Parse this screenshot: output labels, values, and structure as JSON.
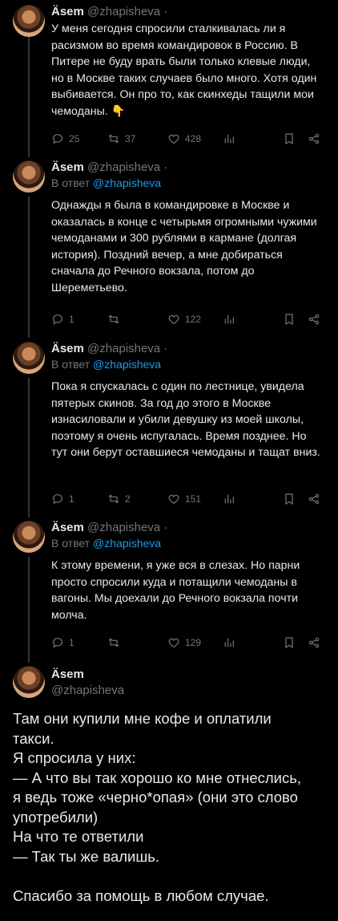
{
  "tweets": [
    {
      "name": "Äsem",
      "handle": "@zhapisheva ·",
      "reply_to": "",
      "text": "У меня сегодня спросили сталкивалась ли я расизмом во время командировок в Россию. В Питере не буду врать были только клевые люди, но в Москве таких случаев было много. Хотя один выбивается. Он про то, как скинхеды тащили мои чемоданы. 👇",
      "stats": {
        "replies": "25",
        "retweets": "37",
        "likes": "428"
      }
    },
    {
      "name": "Äsem",
      "handle": "@zhapisheva ·",
      "reply_prefix": "В ответ",
      "reply_to": "@zhapisheva",
      "text": "Однажды я была в командировке в Москве и оказалась в конце с четырьмя огромными чужими чемоданами и 300 рублями в кармане (долгая история). Поздний вечер, а мне добираться сначала до Речного вокзала, потом до Шереметьево.",
      "stats": {
        "replies": "1",
        "retweets": "",
        "likes": "122"
      }
    },
    {
      "name": "Äsem",
      "handle": "@zhapisheva ·",
      "reply_prefix": "В ответ",
      "reply_to": "@zhapisheva",
      "text": "Пока я спускалась с один по лестнице, увидела пятерых скинов. За год до этого в Москве изнасиловали и убили девушку из моей школы, поэтому я очень испугалась. Время позднее. Но тут они берут оставшиеся чемоданы и тащат вниз.",
      "stats": {
        "replies": "1",
        "retweets": "2",
        "likes": "151"
      }
    },
    {
      "name": "Äsem",
      "handle": "@zhapisheva ·",
      "reply_prefix": "В ответ",
      "reply_to": "@zhapisheva",
      "text": "К этому времени, я уже вся в слезах. Но парни просто спросили куда и потащили чемоданы в вагоны. Мы доехали до Речного вокзала почти молча.",
      "stats": {
        "replies": "1",
        "retweets": "",
        "likes": "129"
      }
    }
  ],
  "main_tweet": {
    "name": "Äsem",
    "handle": "@zhapisheva",
    "lines": [
      "Там они купили мне кофе и оплатили",
      "такси.",
      "Я спросила у них:",
      "— А что вы так хорошо ко мне отнеслись,",
      "я ведь тоже «черно*опая» (они это слово",
      "употребили)",
      "На что те ответили",
      "— Так ты же валишь.",
      "",
      "Спасибо за помощь в любом случае."
    ]
  },
  "icons": [
    "reply-icon",
    "retweet-icon",
    "like-icon",
    "views-icon",
    "bookmark-icon",
    "share-icon"
  ],
  "colors": {
    "background": "#000000",
    "text": "#e7e9ea",
    "muted": "#71767b",
    "link": "#1d9bf0",
    "line": "#333639"
  }
}
